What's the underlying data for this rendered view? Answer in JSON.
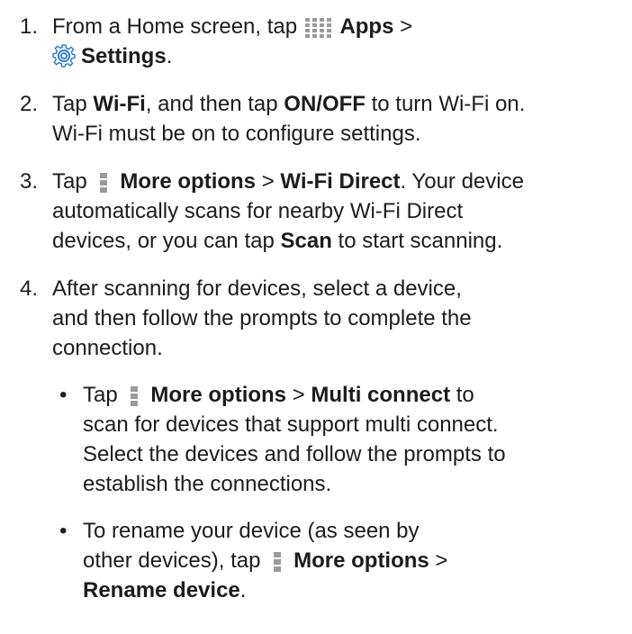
{
  "steps": [
    {
      "number": "1.",
      "parts": {
        "l1_a": "From a Home screen, tap ",
        "l1_b": "Apps",
        "l1_c": " >",
        "l2_a": "Settings",
        "l2_b": "."
      }
    },
    {
      "number": "2.",
      "parts": {
        "l1_a": "Tap ",
        "l1_b": "Wi-Fi",
        "l1_c": ", and then tap ",
        "l1_d": "ON/OFF",
        "l1_e": " to turn Wi-Fi on.",
        "l2_a": "Wi-Fi must be on to configure settings."
      }
    },
    {
      "number": "3.",
      "parts": {
        "l1_a": "Tap ",
        "l1_b": "More options",
        "l1_c": " > ",
        "l1_d": "Wi-Fi Direct",
        "l1_e": ". Your device",
        "l2_a": "automatically scans for nearby Wi-Fi Direct",
        "l3_a": "devices, or you can tap ",
        "l3_b": "Scan",
        "l3_c": " to start scanning."
      }
    },
    {
      "number": "4.",
      "parts": {
        "l1_a": "After scanning for devices, select a device,",
        "l2_a": "and then follow the prompts to complete the",
        "l3_a": "connection."
      }
    }
  ],
  "bullets": [
    {
      "symbol": "•",
      "parts": {
        "l1_a": "Tap ",
        "l1_b": "More options",
        "l1_c": " > ",
        "l1_d": "Multi connect",
        "l1_e": " to",
        "l2_a": "scan for devices that support multi connect.",
        "l3_a": "Select the devices and follow the prompts to",
        "l4_a": "establish the connections."
      }
    },
    {
      "symbol": "•",
      "parts": {
        "l1_a": "To rename your device (as seen by",
        "l2_a": "other devices), tap ",
        "l2_b": "More options",
        "l2_c": " >",
        "l3_a": "Rename device",
        "l3_b": "."
      }
    }
  ],
  "icons": {
    "apps": "apps-grid-icon",
    "settings": "settings-gear-icon",
    "more_options": "more-options-icon"
  },
  "colors": {
    "text": "#1c1c1c",
    "icon_gray": "#9a9a9a",
    "gear_blue": "#1f6fc5",
    "gear_light": "#cfe6fb"
  }
}
